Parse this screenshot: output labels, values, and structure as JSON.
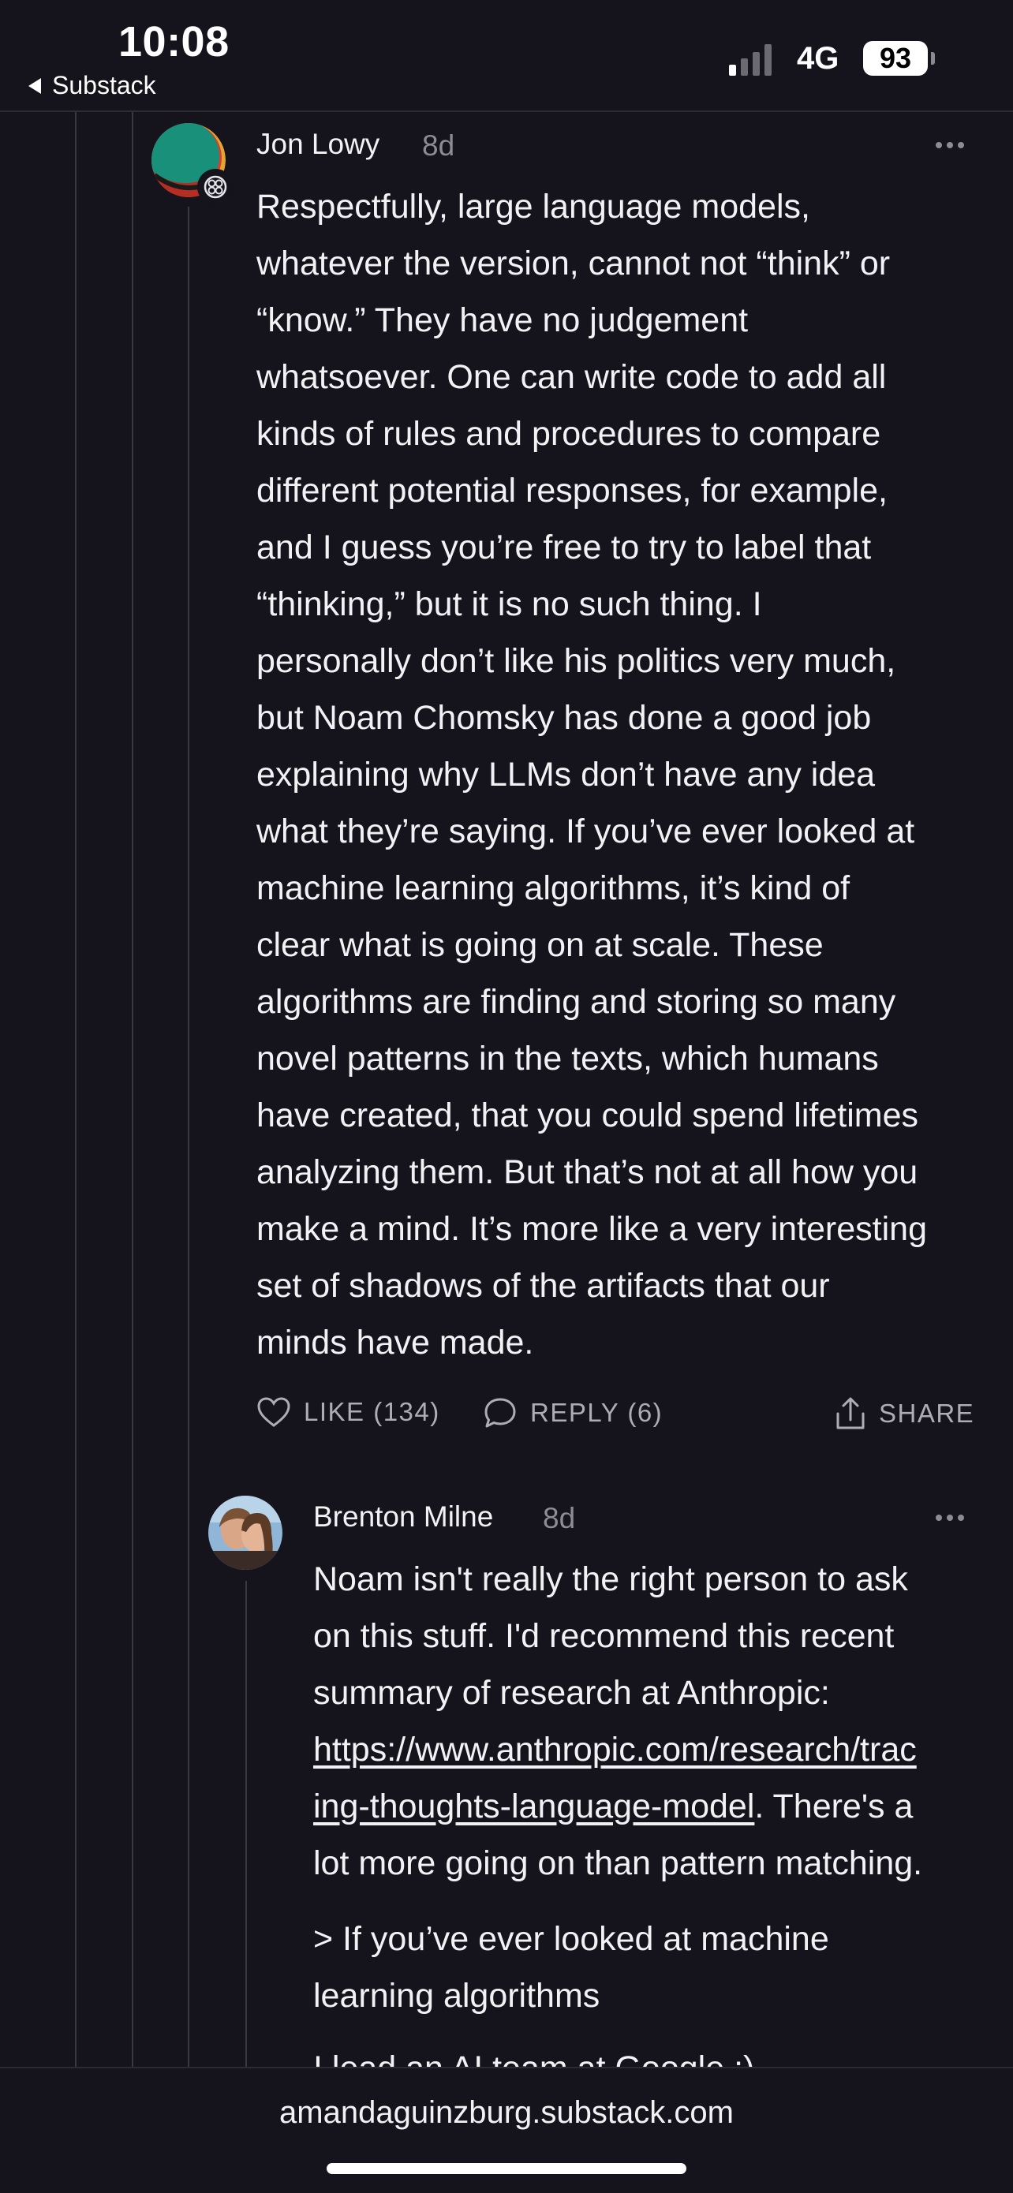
{
  "status_bar": {
    "time": "10:08",
    "back_label": "Substack",
    "network": "4G",
    "battery": "93"
  },
  "comments": [
    {
      "author": "Jon Lowy",
      "time": "8d",
      "body_lines": [
        "Respectfully, large language models,",
        "whatever the version, cannot not “think” or",
        "“know.” They have no judgement",
        "whatsoever. One can write code to add all",
        "kinds of rules and procedures to compare",
        "different potential responses, for example,",
        "and I guess you’re free to try to label that",
        "“thinking,” but it is no such thing. I",
        "personally don’t like his politics very much,",
        "but Noam Chomsky has done a good job",
        "explaining why LLMs don’t have any idea",
        "what they’re saying. If you’ve ever looked at",
        "machine learning algorithms, it’s kind of",
        "clear what is going on at scale. These",
        "algorithms are finding and storing so many",
        "novel patterns in the texts, which humans",
        "have created, that you could spend lifetimes",
        "analyzing them. But that’s not at all how you",
        "make a mind. It’s more like a very interesting",
        "set of shadows of the artifacts that our",
        "minds have made."
      ],
      "like_label": "LIKE (134)",
      "reply_label": "REPLY (6)",
      "share_label": "SHARE"
    },
    {
      "author": "Brenton Milne",
      "time": "8d",
      "line_1": "Noam isn't really the right person to ask",
      "line_2": "on this stuff. I'd recommend this recent",
      "line_3": "summary of research at Anthropic:",
      "link_part_1": "https://www.anthropic.com/research/trac",
      "link_part_2": "ing-thoughts-language-model",
      "after_link": ". There's a",
      "line_6": "lot more going on than pattern matching.",
      "quote_lines": [
        "> If you’ve ever looked at machine",
        "learning algorithms"
      ],
      "partial_line": "I lead an AI team at Google :)"
    }
  ],
  "bottom_bar": {
    "url": "amandaguinzburg.substack.com"
  },
  "colors": {
    "background": "#15131c",
    "text": "#f2f2f4",
    "muted": "#8d8b94",
    "thread_line": "#3a3841"
  }
}
